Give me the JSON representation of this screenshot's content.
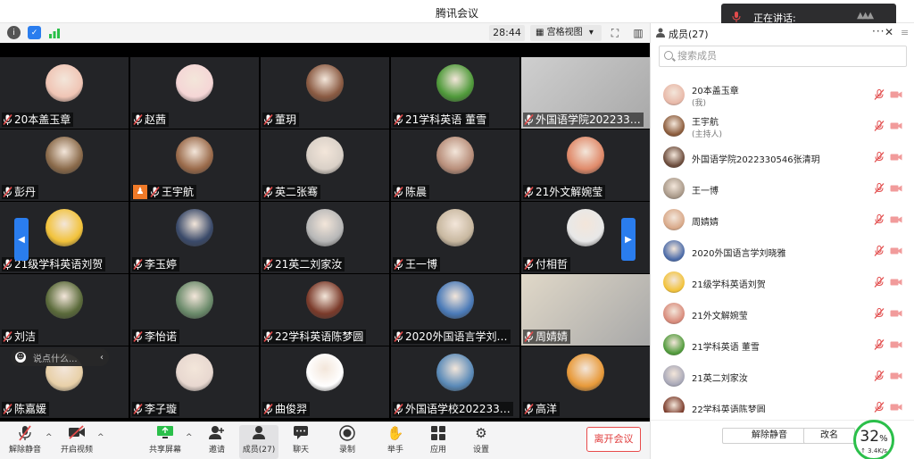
{
  "app": {
    "title": "腾讯会议"
  },
  "speaking_popup": {
    "label": "正在讲话:"
  },
  "topbar": {
    "timer": "28:44",
    "view_mode": "宫格视图",
    "view_caret": "▾"
  },
  "tiles": [
    {
      "name": "20本盖玉章",
      "bg": "#f0c5b5"
    },
    {
      "name": "赵茜",
      "bg": "#f5d6d6"
    },
    {
      "name": "董玥",
      "bg": "#8a5a42"
    },
    {
      "name": "21学科英语 董雪",
      "bg": "#4f9a3a"
    },
    {
      "name": "外国语学院202233…",
      "bg": "#cfcfcf",
      "video": true
    },
    {
      "name": "彭丹",
      "bg": "#8a6a4a"
    },
    {
      "name": "王宇航",
      "bg": "#9a6a4a",
      "host": true
    },
    {
      "name": "英二张骞",
      "bg": "#d9d0c7"
    },
    {
      "name": "陈晨",
      "bg": "#b88e7a"
    },
    {
      "name": "21外文解婉莹",
      "bg": "#e08a6a"
    },
    {
      "name": "21级学科英语刘贺",
      "bg": "#f2c23a"
    },
    {
      "name": "李玉婷",
      "bg": "#3a4a6a"
    },
    {
      "name": "21英二刘家汝",
      "bg": "#b7b7b7"
    },
    {
      "name": "王一博",
      "bg": "#c8b8a0"
    },
    {
      "name": "付相哲",
      "bg": "#e8e8e8"
    },
    {
      "name": "刘洁",
      "bg": "#5a6a3a"
    },
    {
      "name": "李怡诺",
      "bg": "#6a8a6a"
    },
    {
      "name": "22学科英语陈梦圆",
      "bg": "#7a3a2a"
    },
    {
      "name": "2020外国语言学刘…",
      "bg": "#4a7ab8"
    },
    {
      "name": "周婧婧",
      "bg": "#e0d8c8",
      "video": true
    },
    {
      "name": "陈嘉媛",
      "bg": "#e8d0a8"
    },
    {
      "name": "李子璇",
      "bg": "#e8d8d0"
    },
    {
      "name": "曲俊羿",
      "bg": "#ffffff"
    },
    {
      "name": "外国语学校202233…",
      "bg": "#5a8ab8"
    },
    {
      "name": "高洋",
      "bg": "#e89a3a"
    }
  ],
  "chat": {
    "placeholder": "说点什么...",
    "smile": "☻",
    "arrow": "‹"
  },
  "paging": {
    "left": "◀",
    "right": "▶"
  },
  "bottombar": {
    "unmute": "解除静音",
    "start_video": "开启视频",
    "share_screen": "共享屏幕",
    "invite": "邀请",
    "members": "成员(27)",
    "chat": "聊天",
    "record": "录制",
    "raise_hand": "举手",
    "apps": "应用",
    "settings": "设置",
    "leave": "离开会议",
    "caret": "^"
  },
  "panel": {
    "title": "成员(27)",
    "more": "···",
    "close": "✕",
    "menu": "≡",
    "search_placeholder": "搜索成员",
    "members": [
      {
        "name": "20本盖玉章",
        "role": "(我)",
        "color": "#e8b8a8"
      },
      {
        "name": "王宇航",
        "role": "(主持人)",
        "color": "#8a5a3a"
      },
      {
        "name": "外国语学院2022330546张清玥",
        "color": "#6a4a3a"
      },
      {
        "name": "王一博",
        "color": "#a89888"
      },
      {
        "name": "周婧婧",
        "color": "#d8a888"
      },
      {
        "name": "2020外国语言学刘晓雅",
        "color": "#4a6aa8"
      },
      {
        "name": "21级学科英语刘贺",
        "color": "#f2c23a"
      },
      {
        "name": "21外文解婉莹",
        "color": "#d88a7a"
      },
      {
        "name": "21学科英语 董雪",
        "color": "#4f9a3a"
      },
      {
        "name": "21英二刘家汝",
        "color": "#a8a8b8"
      },
      {
        "name": "22学科英语陈梦圆",
        "color": "#7a3a2a"
      }
    ],
    "footer": {
      "unmute": "解除静音",
      "rename": "改名"
    }
  },
  "network": {
    "percent": "32",
    "percent_unit": "%",
    "speed": "↑ 3.4K/s"
  },
  "colors": {
    "accent": "#2a7dee",
    "leave": "#e03c3c",
    "muted": "#e24b4b",
    "network": "#2bbf4a"
  }
}
